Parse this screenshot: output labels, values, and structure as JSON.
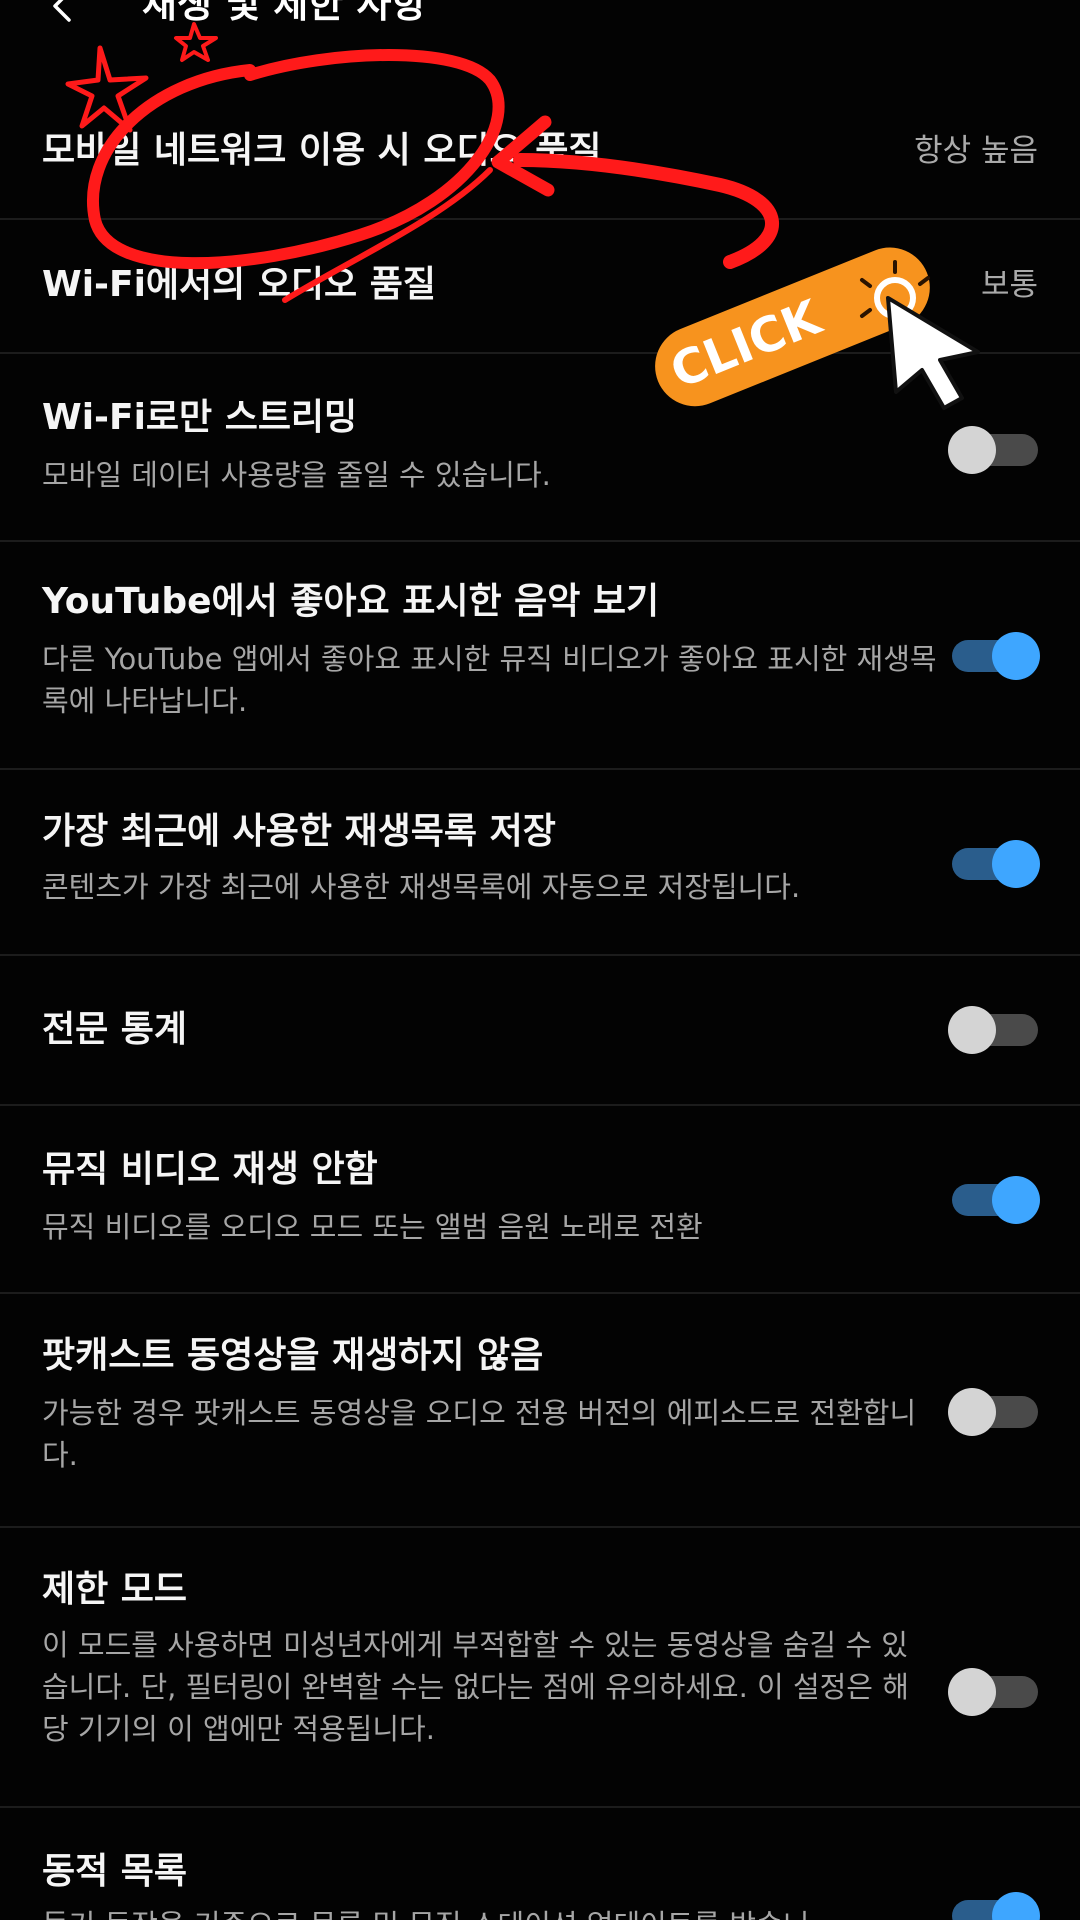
{
  "header": {
    "title": "재생 및 제한 사항"
  },
  "settings": [
    {
      "title": "모바일 네트워크 이용 시 오디오 품질",
      "value": "항상 높음"
    },
    {
      "title": "Wi-Fi에서의 오디오 품질",
      "value": "보통"
    },
    {
      "title": "Wi-Fi로만 스트리밍",
      "desc": "모바일 데이터 사용량을 줄일 수 있습니다.",
      "enabled": false
    },
    {
      "title": "YouTube에서 좋아요 표시한 음악 보기",
      "desc": "다른 YouTube 앱에서 좋아요 표시한 뮤직 비디오가 좋아요 표시한 재생목록에 나타납니다.",
      "enabled": true
    },
    {
      "title": "가장 최근에 사용한 재생목록 저장",
      "desc": "콘텐츠가 가장 최근에 사용한 재생목록에 자동으로 저장됩니다.",
      "enabled": true
    },
    {
      "title": "전문 통계",
      "enabled": false
    },
    {
      "title": "뮤직 비디오 재생 안함",
      "desc": "뮤직 비디오를 오디오 모드 또는 앨범 음원 노래로 전환",
      "enabled": true
    },
    {
      "title": "팟캐스트 동영상을 재생하지 않음",
      "desc": "가능한 경우 팟캐스트 동영상을 오디오 전용 버전의 에피소드로 전환합니다.",
      "enabled": false
    },
    {
      "title": "제한 모드",
      "desc": "이 모드를 사용하면 미성년자에게 부적합할 수 있는 동영상을 숨길 수 있습니다. 단, 필터링이 완벽할 수는 없다는 점에 유의하세요. 이 설정은 해당 기기의 이 앱에만 적용됩니다.",
      "enabled": false
    },
    {
      "title": "동적 목록",
      "desc": "듣기 동작을 기준으로 목록 및 뮤직 스테이션 업데이트를 받습니",
      "enabled": true
    }
  ],
  "annotation": {
    "click_label": "CLICK",
    "brand_color": "#f7931e",
    "marker_color": "#ff1a1a"
  }
}
